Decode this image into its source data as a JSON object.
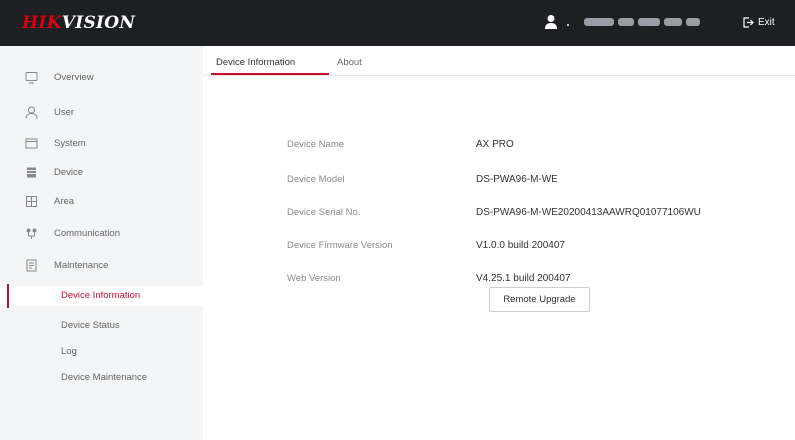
{
  "header": {
    "logo_red": "HIK",
    "logo_white": "VISION",
    "exit_label": "Exit"
  },
  "sidebar": {
    "items": [
      {
        "label": "Overview",
        "icon": "overview-icon"
      },
      {
        "label": "User",
        "icon": "user-icon"
      },
      {
        "label": "System",
        "icon": "system-icon"
      },
      {
        "label": "Device",
        "icon": "device-icon"
      },
      {
        "label": "Area",
        "icon": "area-icon"
      },
      {
        "label": "Communication",
        "icon": "communication-icon"
      },
      {
        "label": "Maintenance",
        "icon": "maintenance-icon"
      }
    ],
    "sub_items": [
      {
        "label": "Device Information",
        "active": true
      },
      {
        "label": "Device Status",
        "active": false
      },
      {
        "label": "Log",
        "active": false
      },
      {
        "label": "Device Maintenance",
        "active": false
      }
    ]
  },
  "main": {
    "tabs": [
      {
        "label": "Device Information",
        "active": true
      },
      {
        "label": "About",
        "active": false
      }
    ],
    "info": [
      {
        "key": "Device Name",
        "value": "AX PRO"
      },
      {
        "key": "Device Model",
        "value": "DS-PWA96-M-WE"
      },
      {
        "key": "Device Serial No.",
        "value": "DS-PWA96-M-WE20200413AAWRQ01077106WU"
      },
      {
        "key": "Device Firmware Version",
        "value": "V1.0.0 build 200407"
      },
      {
        "key": "Web Version",
        "value": "V4.25.1 build 200407"
      }
    ],
    "upgrade_button": "Remote Upgrade"
  },
  "colors": {
    "accent": "#c8102e",
    "header_bg": "#1d1f23",
    "sidebar_bg": "#f4f5f6"
  }
}
